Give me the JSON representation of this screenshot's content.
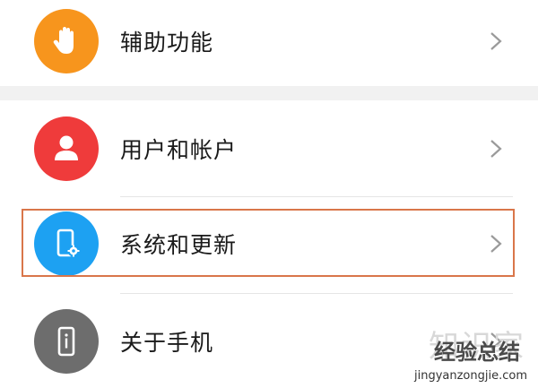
{
  "settings": {
    "items": [
      {
        "label": "辅助功能",
        "icon": "hand-icon",
        "color": "#f7951d"
      },
      {
        "label": "用户和帐户",
        "icon": "user-icon",
        "color": "#ef3b3b"
      },
      {
        "label": "系统和更新",
        "icon": "phone-gear-icon",
        "color": "#1da1f2"
      },
      {
        "label": "关于手机",
        "icon": "phone-info-icon",
        "color": "#6d6d6d"
      }
    ]
  },
  "watermark": {
    "title": "知识家",
    "brand": "经验总结",
    "url": "jingyanzongjie.com"
  },
  "colors": {
    "highlight": "#d9764a",
    "divider": "#e5e5e5",
    "section_gap": "#f1f1f1"
  }
}
